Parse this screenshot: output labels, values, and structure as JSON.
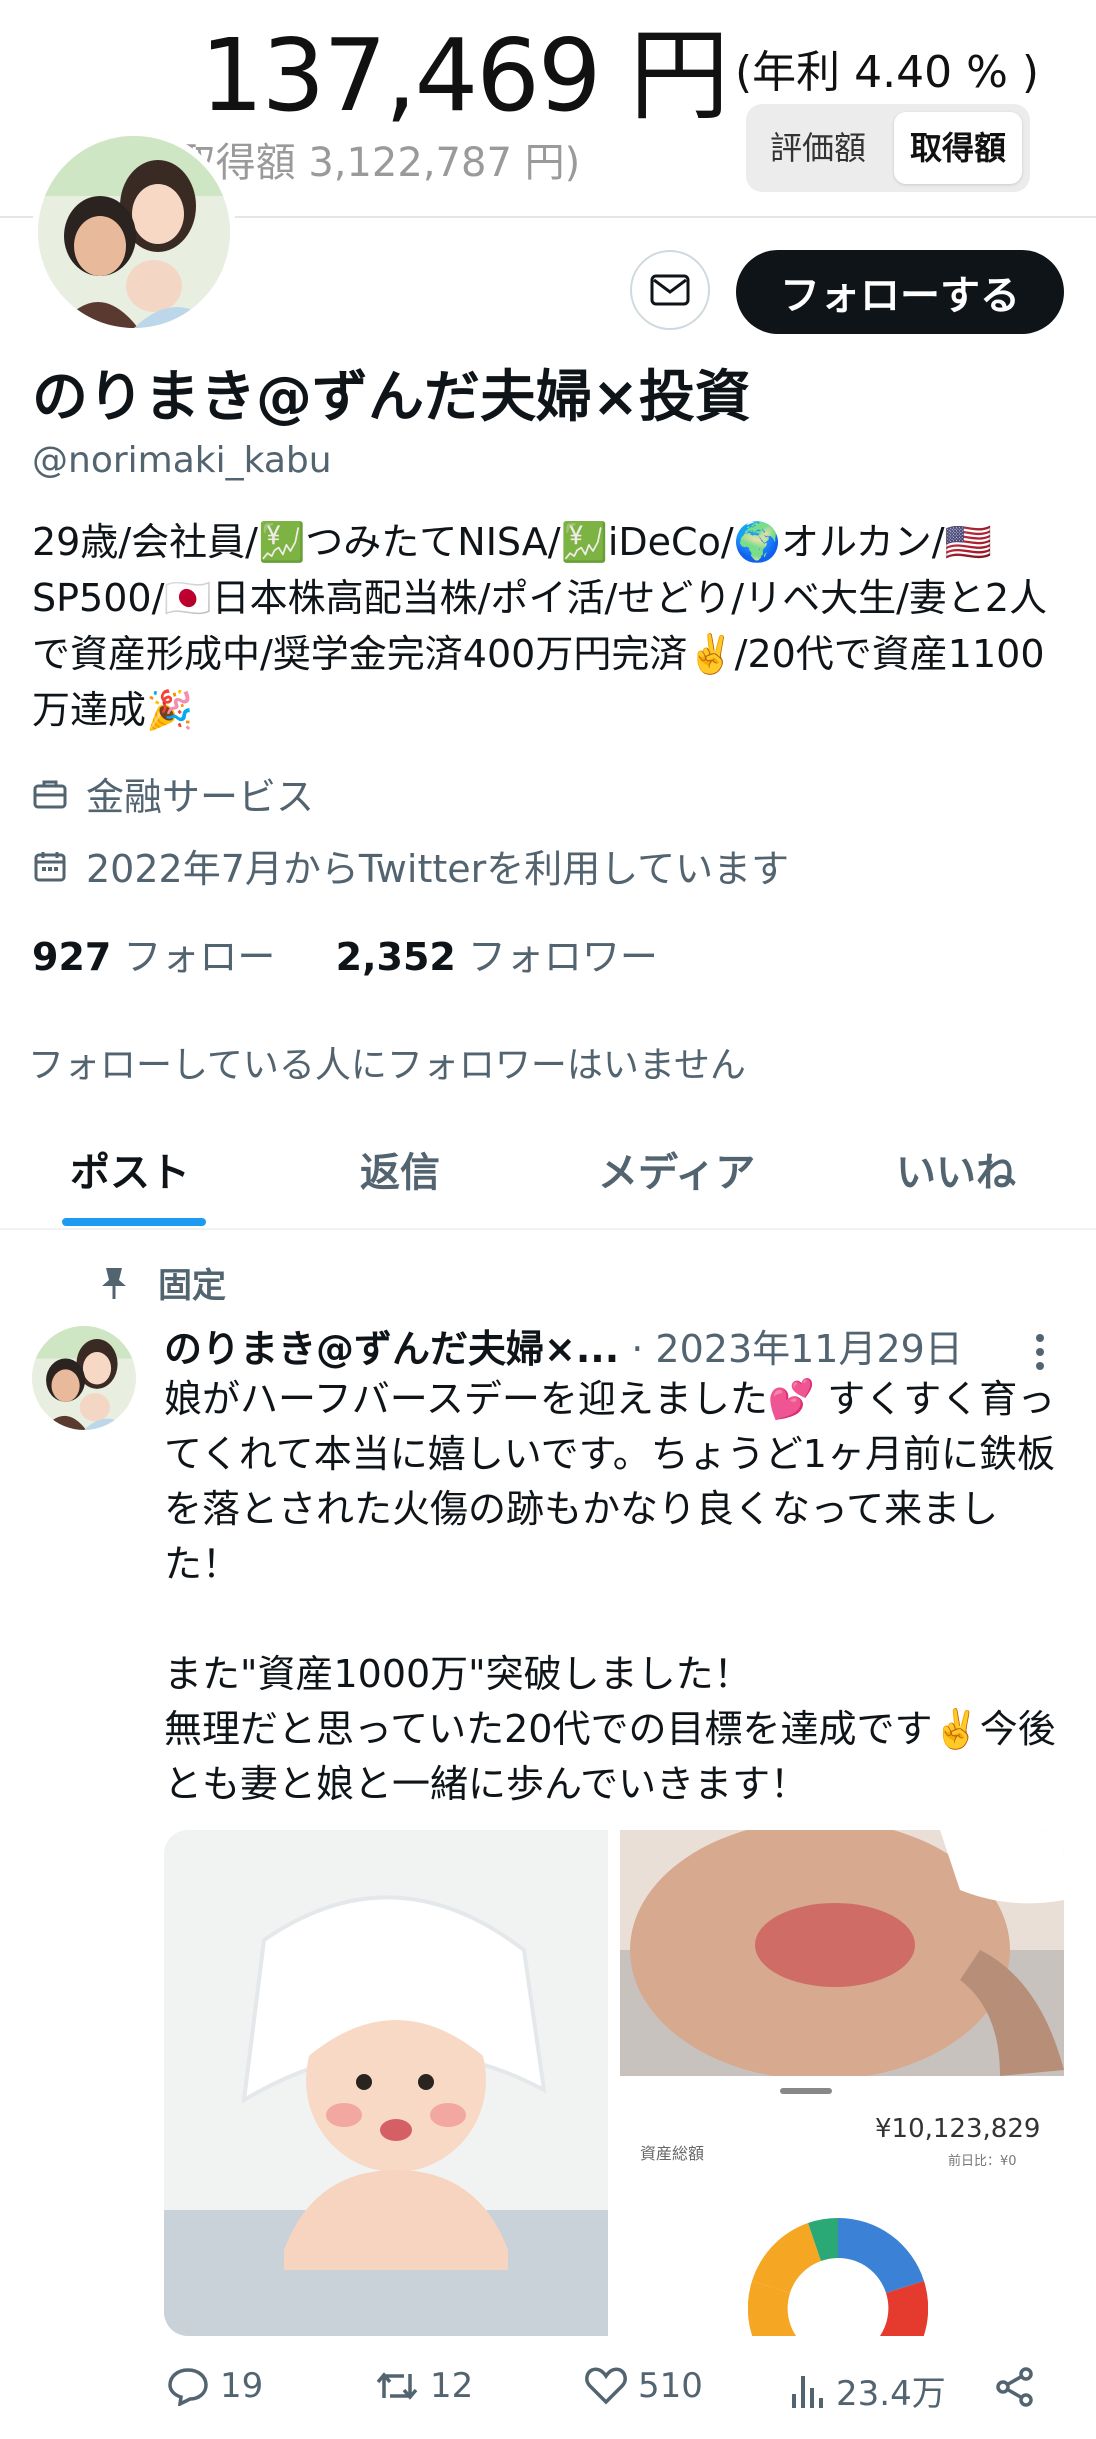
{
  "banner": {
    "amount": "137,469 円",
    "rate": "(年利 4.40 % )",
    "sub": "(株取得額 3,122,787 円)",
    "toggle_left": "評価額",
    "toggle_right": "取得額"
  },
  "profile": {
    "follow_label": "フォローする",
    "name": "のりまき@ずんだ夫婦×投資",
    "handle": "@norimaki_kabu",
    "bio": "29歳/会社員/💹つみたてNISA/💹iDeCo/🌍オルカン/🇺🇸SP500/🇯🇵日本株高配当株/ポイ活/せどり/リベ大生/妻と2人で資産形成中/奨学金完済400万円完済✌️/20代で資産1100万達成🎉",
    "category": "金融サービス",
    "joined": "2022年7月からTwitterを利用しています",
    "following_count": "927",
    "following_label": "フォロー",
    "followers_count": "2,352",
    "followers_label": "フォロワー",
    "no_mutual": "フォローしている人にフォロワーはいません"
  },
  "tabs": [
    "ポスト",
    "返信",
    "メディア",
    "いいね"
  ],
  "post": {
    "pinned_label": "固定",
    "author": "のりまき@ずんだ夫婦×...",
    "date": "· 2023年11月29日",
    "text": "娘がハーフバースデーを迎えました💕 すくすく育ってくれて本当に嬉しいです。ちょうど1ヶ月前に鉄板を落とされた火傷の跡もかなり良くなって来ました！\n\nまた\"資産1000万\"突破しました！\n無理だと思っていた20代での目標を達成です✌️今後とも妻と娘と一緒に歩んでいきます！",
    "asset_label": "資産総額",
    "asset_value": "¥10,123,829",
    "asset_sub": "前日比：¥0",
    "replies": "19",
    "reposts": "12",
    "likes": "510",
    "views": "23.4万"
  },
  "colors": {
    "accent": "#1d9bf0",
    "follow_button": "#0f1419",
    "secondary_text": "#536471"
  }
}
